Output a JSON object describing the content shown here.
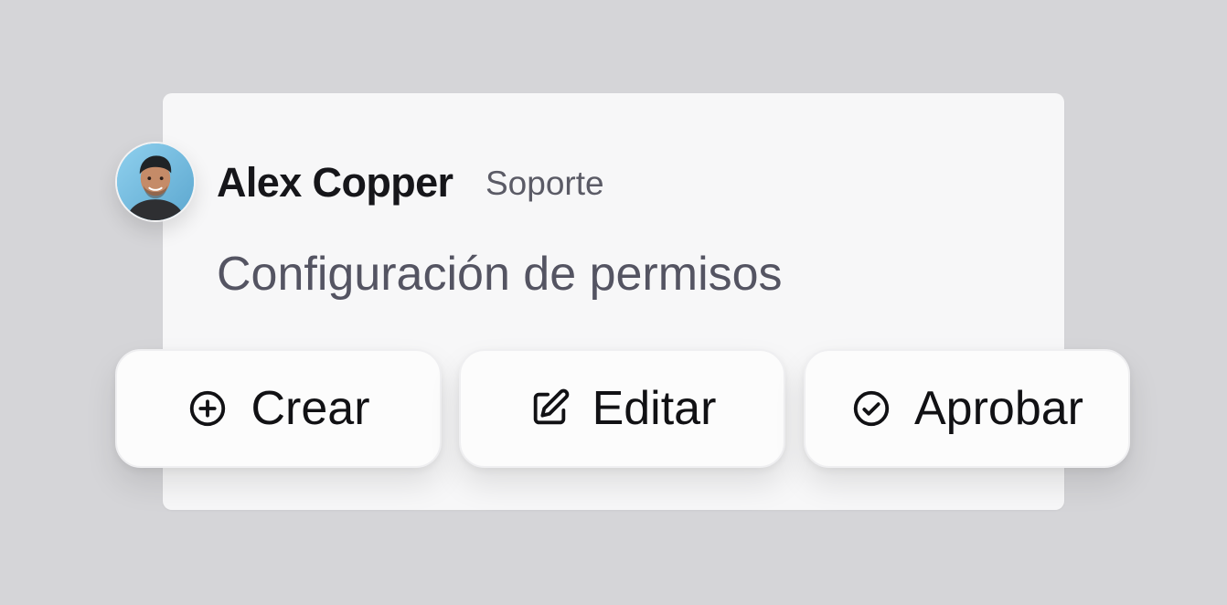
{
  "user": {
    "name": "Alex Copper",
    "role": "Soporte"
  },
  "message": {
    "text": "Configuración de permisos"
  },
  "actions": [
    {
      "label": "Crear",
      "icon": "plus-circle-icon"
    },
    {
      "label": "Editar",
      "icon": "edit-icon"
    },
    {
      "label": "Aprobar",
      "icon": "check-circle-icon"
    }
  ],
  "colors": {
    "background": "#d5d5d8",
    "card": "#f7f7f8",
    "button": "#fcfcfc",
    "name_text": "#16161a",
    "role_text": "#5b5b66",
    "message_text": "#545462"
  }
}
